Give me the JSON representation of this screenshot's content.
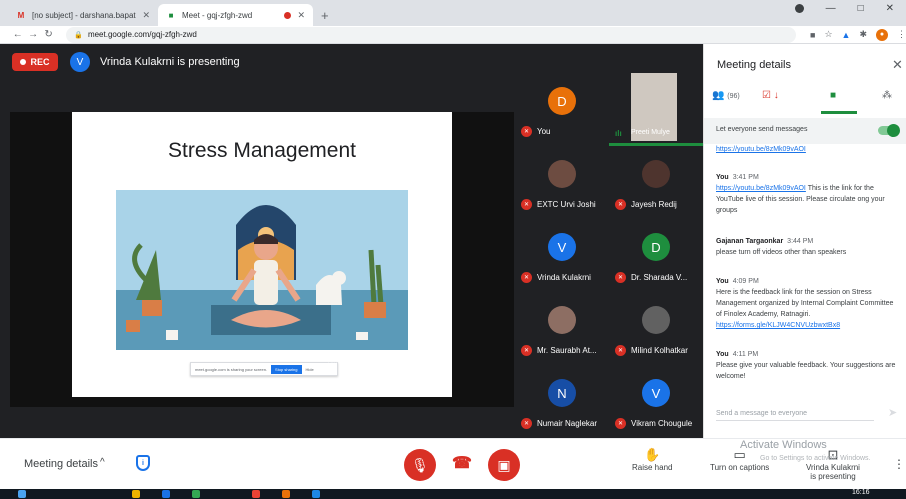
{
  "browser": {
    "tabs": [
      {
        "title": "[no subject] - darshana.bapat@f...",
        "favicon": "gmail-icon",
        "active": false
      },
      {
        "title": "Meet - gqj-zfgh-zwd",
        "favicon": "meet-icon",
        "active": true
      }
    ],
    "new_tab": "+",
    "url": "meet.google.com/gqj-zfgh-zwd"
  },
  "meet": {
    "rec_label": "REC",
    "presenter_initial": "V",
    "presenting_text": "Vrinda Kulakrni is presenting",
    "slide_title": "Stress Management",
    "share_bar": {
      "text": "meet.google.com is sharing your screen.",
      "stop": "Stop sharing",
      "hide": "Hide"
    },
    "watermark_slide": [
      "Activate Windows",
      "Go to PC settings to activate Windows."
    ]
  },
  "participants": [
    {
      "name": "You",
      "initial": "D",
      "color": "#e8710a",
      "muted": true,
      "photo": false
    },
    {
      "name": "Preeti Mulye",
      "presenting": true
    },
    {
      "name": "EXTC Urvi Joshi",
      "initial": "",
      "color": "#6d4c41",
      "muted": true,
      "photo": true
    },
    {
      "name": "Jayesh Redij",
      "initial": "",
      "color": "#4e342e",
      "muted": true,
      "photo": true
    },
    {
      "name": "Vrinda Kulakrni",
      "initial": "V",
      "color": "#1a73e8",
      "muted": true,
      "photo": false
    },
    {
      "name": "Dr. Sharada V...",
      "initial": "D",
      "color": "#1e8e3e",
      "muted": true,
      "photo": false
    },
    {
      "name": "Mr. Saurabh At...",
      "initial": "",
      "color": "#8d6e63",
      "muted": true,
      "photo": true
    },
    {
      "name": "Milind Kolhatkar",
      "initial": "",
      "color": "#616161",
      "muted": true,
      "photo": true
    },
    {
      "name": "Numair Naglekar",
      "initial": "N",
      "color": "#174ea6",
      "muted": true,
      "photo": false
    },
    {
      "name": "Vikram Chougule",
      "initial": "V",
      "color": "#1a73e8",
      "muted": true,
      "photo": false
    }
  ],
  "controls": {
    "meeting_details": "Meeting details",
    "raise_hand": "Raise hand",
    "turn_on_captions": "Turn on captions",
    "presenting_line1": "Vrinda Kulakrni",
    "presenting_line2": "is presenting",
    "watermark": "Activate Windows",
    "watermark_sub": "Go to Settings to activate Windows."
  },
  "panel": {
    "title": "Meeting details",
    "people_count": "(96)",
    "toggle_label": "Let everyone send messages",
    "cut_link": "https://youtu.be/8zMk09vAOI",
    "messages": [
      {
        "sender": "You",
        "time": "3:41 PM",
        "link": "https://youtu.be/8zMk09vAOI",
        "text": " This is the link for the YouTube live of this session. Please circulate ong your groups"
      },
      {
        "sender": "Gajanan Targaonkar",
        "time": "3:44 PM",
        "link": "",
        "text": "please turn off videos other than speakers"
      },
      {
        "sender": "You",
        "time": "4:09 PM",
        "link": "https://forms.gle/KLJW4CNVUzbwxtBx8",
        "text": "Here is the feedback link for the session on Stress Management organized by Internal Complaint Committee of Finolex Academy, Ratnagiri."
      },
      {
        "sender": "You",
        "time": "4:11 PM",
        "link": "",
        "text": "Please give your valuable feedback. Your suggestions are welcome!"
      }
    ],
    "input_placeholder": "Send a message to everyone"
  },
  "taskbar": {
    "clock": "16:16"
  }
}
